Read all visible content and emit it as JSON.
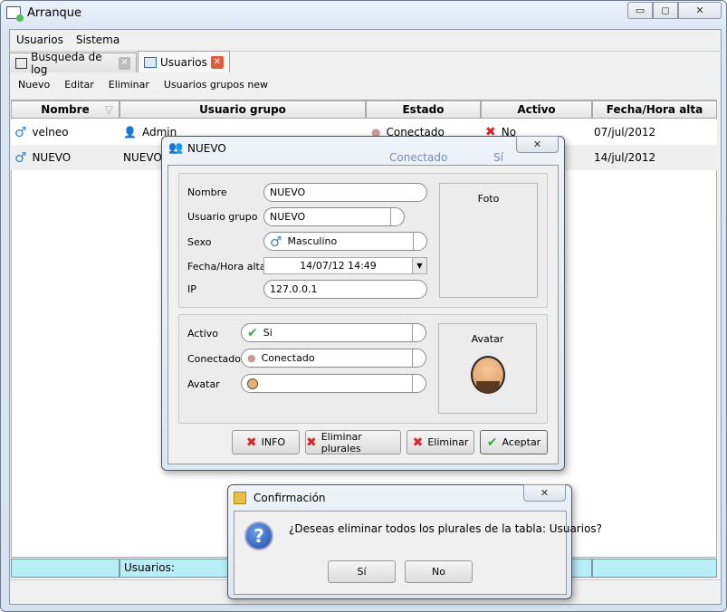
{
  "window": {
    "title": "Arranque",
    "controls": [
      "minimize",
      "maximize",
      "close"
    ]
  },
  "menu": [
    "Usuarios",
    "Sistema"
  ],
  "tabs": [
    {
      "label": "Busqueda de log",
      "active": false
    },
    {
      "label": "Usuarios",
      "active": true
    }
  ],
  "toolbar": [
    "Nuevo",
    "Editar",
    "Eliminar",
    "Usuarios grupos new"
  ],
  "table": {
    "columns": [
      "Nombre",
      "Usuario grupo",
      "Estado",
      "Activo",
      "Fecha/Hora alta"
    ],
    "rows": [
      {
        "nombre": "velneo",
        "grupo": "Admin",
        "estado": "Conectado",
        "activo": "No",
        "fecha": "07/jul/2012"
      },
      {
        "nombre": "NUEVO",
        "grupo": "NUEVO",
        "estado": "Conectado",
        "activo": "Sí",
        "fecha": "14/jul/2012"
      }
    ]
  },
  "footer": {
    "label": "Usuarios:"
  },
  "dialog": {
    "title": "NUEVO",
    "fields": {
      "nombre_label": "Nombre",
      "nombre": "NUEVO",
      "grupo_label": "Usuario grupo",
      "grupo": "NUEVO",
      "sexo_label": "Sexo",
      "sexo": "Masculino",
      "fecha_label": "Fecha/Hora alta",
      "fecha": "14/07/12 14:49",
      "ip_label": "IP",
      "ip": "127.0.0.1",
      "activo_label": "Activo",
      "activo": "Si",
      "conectado_label": "Conectado",
      "conectado": "Conectado",
      "avatar_label": "Avatar"
    },
    "foto_label": "Foto",
    "avatar_panel_label": "Avatar",
    "buttons": [
      "INFO",
      "Eliminar plurales",
      "Eliminar",
      "Aceptar"
    ]
  },
  "confirm": {
    "title": "Confirmación",
    "message": "¿Deseas eliminar todos los plurales de la tabla: Usuarios?",
    "yes": "Sí",
    "no": "No"
  }
}
